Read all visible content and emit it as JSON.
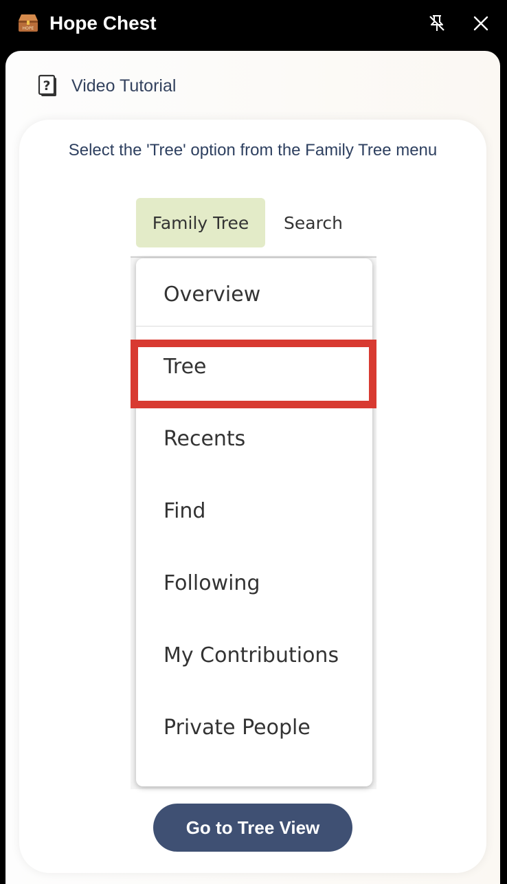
{
  "window": {
    "title": "Hope Chest",
    "logo_icon": "treasure-chest-icon",
    "logo_text": "HOPE",
    "unpin_icon": "unpin-icon",
    "close_icon": "close-icon"
  },
  "panel": {
    "tutorial_label": "Video Tutorial",
    "tutorial_icon": "help-book-icon"
  },
  "step": {
    "instruction": "Select the 'Tree' option from the Family Tree menu"
  },
  "screenshot": {
    "tabs": [
      {
        "label": "Family Tree",
        "active": true
      },
      {
        "label": "Search",
        "active": false
      }
    ],
    "menu_items": [
      {
        "label": "Overview"
      },
      {
        "label": "Tree",
        "highlighted": true
      },
      {
        "label": "Recents"
      },
      {
        "label": "Find"
      },
      {
        "label": "Following"
      },
      {
        "label": "My Contributions"
      },
      {
        "label": "Private People"
      }
    ]
  },
  "actions": {
    "go_button": "Go to Tree View"
  },
  "colors": {
    "titlebar_bg": "#000000",
    "button_bg": "#3f5073",
    "instruction_text": "#2e4060",
    "active_tab_bg": "#e3ebc8",
    "highlight": "#d83a31"
  }
}
